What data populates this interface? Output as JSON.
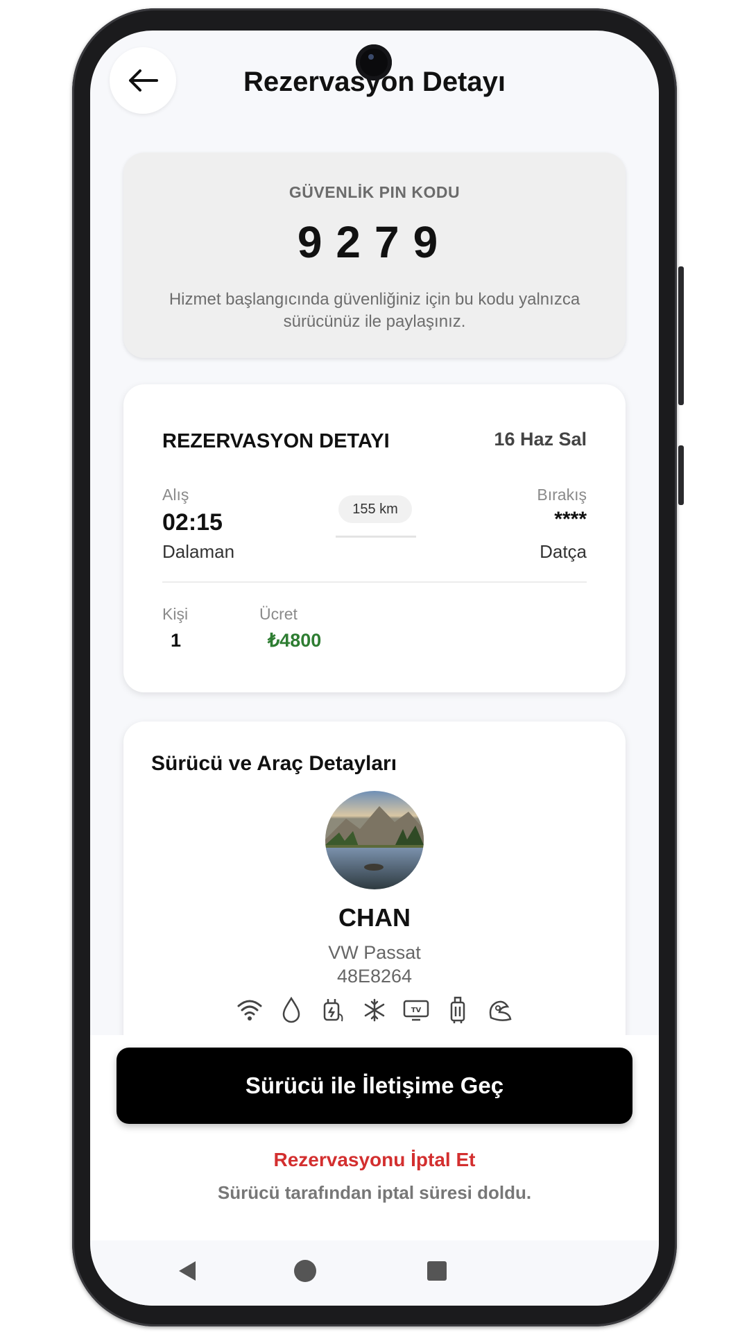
{
  "header": {
    "title": "Rezervasyon Detayı"
  },
  "pin": {
    "label": "GÜVENLİK PIN KODU",
    "code": "9279",
    "note": "Hizmet başlangıcında güvenliğiniz için bu kodu yalnızca sürücünüz ile paylaşınız."
  },
  "reservation": {
    "title": "REZERVASYON DETAYI",
    "date": "16 Haz Sal",
    "pickup_label": "Alış",
    "pickup_time": "02:15",
    "pickup_place": "Dalaman",
    "distance": "155 km",
    "dropoff_label": "Bırakış",
    "dropoff_time": "****",
    "dropoff_place": "Datça",
    "persons_label": "Kişi",
    "persons_value": "1",
    "price_label": "Ücret",
    "price_value": "₺4800",
    "price_color": "#2e7d32"
  },
  "driver": {
    "section_title": "Sürücü ve Araç Detayları",
    "name": "CHAN",
    "car_model": "VW Passat",
    "plate": "48E8264",
    "amenities": [
      "wifi-icon",
      "water-icon",
      "charger-icon",
      "air-conditioning-icon",
      "tv-icon",
      "luggage-icon",
      "child-seat-icon"
    ]
  },
  "actions": {
    "contact_label": "Sürücü ile İletişime Geç",
    "cancel_label": "Rezervasyonu İptal Et",
    "cancel_note": "Sürücü tarafından iptal süresi doldu.",
    "cancel_color": "#d32f2f"
  },
  "navbar": {
    "items": [
      "back-nav-icon",
      "home-nav-icon",
      "recents-nav-icon"
    ]
  }
}
